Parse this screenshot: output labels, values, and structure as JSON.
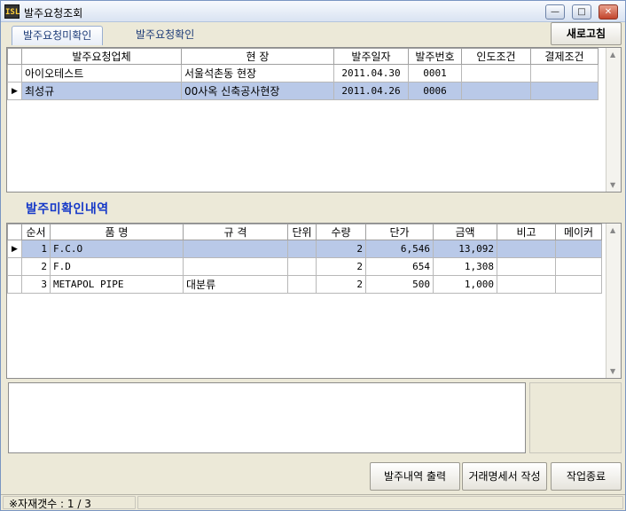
{
  "window": {
    "title": "발주요청조회",
    "app_icon": "ISL"
  },
  "tabs": [
    {
      "label": "발주요청미확인"
    },
    {
      "label": "발주요청확인"
    }
  ],
  "toolbar": {
    "refresh_label": "새로고침"
  },
  "orders": {
    "columns": [
      "발주요청업체",
      "현     장",
      "발주일자",
      "발주번호",
      "인도조건",
      "결제조건"
    ],
    "rows": [
      {
        "company": "아이오테스트",
        "site": "서울석촌동 현장",
        "date": "2011.04.30",
        "number": "0001",
        "delivery": "",
        "payment": ""
      },
      {
        "company": "최성규",
        "site": "00사옥 신축공사현장",
        "date": "2011.04.26",
        "number": "0006",
        "delivery": "",
        "payment": ""
      }
    ]
  },
  "section": {
    "title": "발주미확인내역"
  },
  "items": {
    "columns": [
      "순서",
      "품  명",
      "규   격",
      "단위",
      "수량",
      "단가",
      "금액",
      "비고",
      "메이커"
    ],
    "rows": [
      {
        "seq": "1",
        "name": "F.C.O",
        "spec": "",
        "unit": "",
        "qty": "2",
        "price": "6,546",
        "amount": "13,092",
        "note": "",
        "maker": ""
      },
      {
        "seq": "2",
        "name": "F.D",
        "spec": "",
        "unit": "",
        "qty": "2",
        "price": "654",
        "amount": "1,308",
        "note": "",
        "maker": ""
      },
      {
        "seq": "3",
        "name": "METAPOL PIPE",
        "spec": "대분류",
        "unit": "",
        "qty": "2",
        "price": "500",
        "amount": "1,000",
        "note": "",
        "maker": ""
      }
    ]
  },
  "actions": {
    "print_label": "발주내역 출력",
    "statement_label": "거래명세서 작성",
    "close_label": "작업종료"
  },
  "status": {
    "text": "※자재갯수 : 1 / 3"
  },
  "colors": {
    "selection": "#b9c9e8",
    "section_title": "#1538c8"
  }
}
